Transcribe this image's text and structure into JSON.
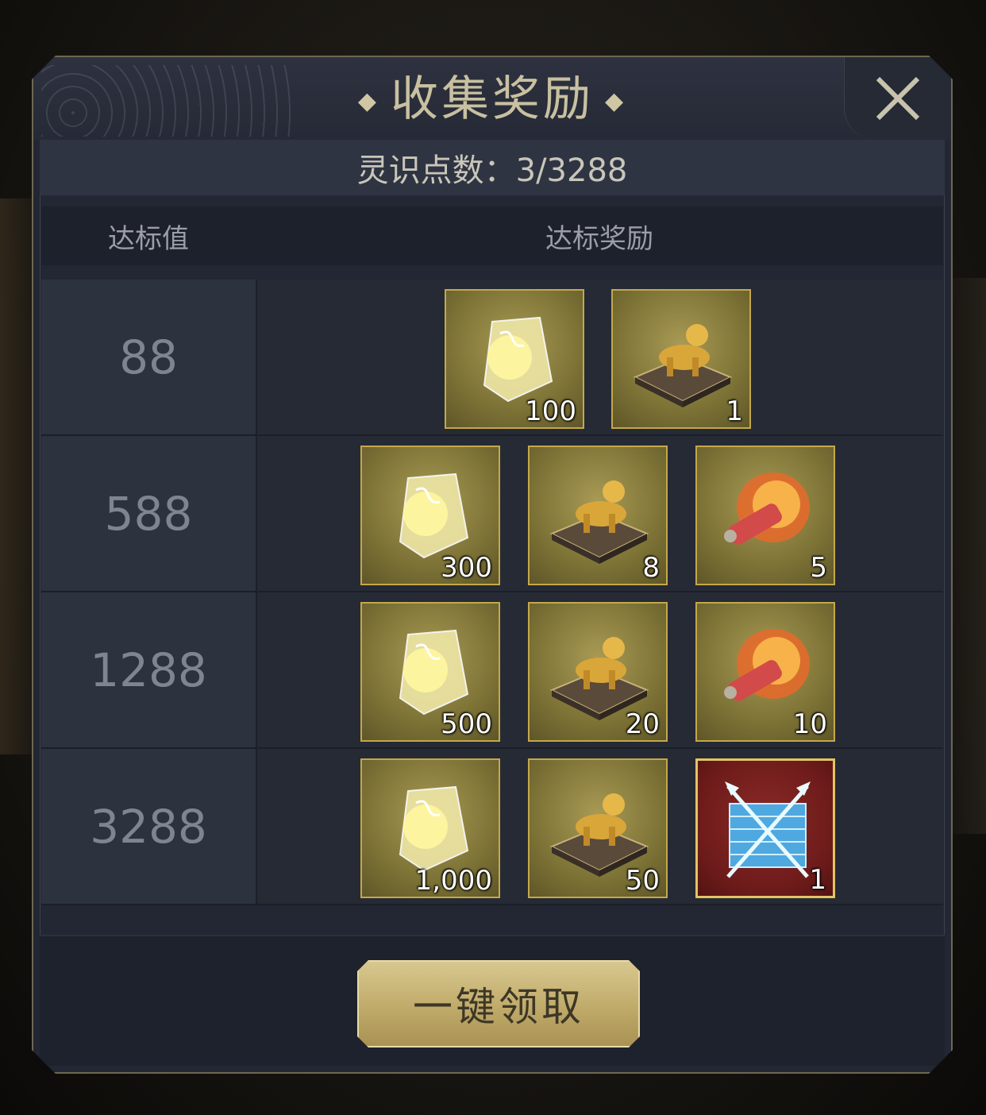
{
  "dialog": {
    "title": "收集奖励",
    "points_label": "灵识点数：3/3288",
    "col_threshold": "达标值",
    "col_reward": "达标奖励",
    "claim_all_label": "一键领取"
  },
  "rows": [
    {
      "threshold": "88",
      "items": [
        {
          "icon": "spirit-card-icon",
          "qty": "100"
        },
        {
          "icon": "golden-beast-statue-icon",
          "qty": "1"
        }
      ]
    },
    {
      "threshold": "588",
      "items": [
        {
          "icon": "spirit-card-icon",
          "qty": "300"
        },
        {
          "icon": "golden-beast-statue-icon",
          "qty": "8"
        },
        {
          "icon": "fire-scroll-icon",
          "qty": "5"
        }
      ]
    },
    {
      "threshold": "1288",
      "items": [
        {
          "icon": "spirit-card-icon",
          "qty": "500"
        },
        {
          "icon": "golden-beast-statue-icon",
          "qty": "20"
        },
        {
          "icon": "fire-scroll-icon",
          "qty": "10"
        }
      ]
    },
    {
      "threshold": "3288",
      "items": [
        {
          "icon": "spirit-card-icon",
          "qty": "1,000"
        },
        {
          "icon": "golden-beast-statue-icon",
          "qty": "50"
        },
        {
          "icon": "crossed-spears-chest-icon",
          "qty": "1"
        }
      ]
    }
  ],
  "colors": {
    "gold": "#c4a84a",
    "panel": "#232733",
    "special_bg": "#6c1b1a"
  }
}
